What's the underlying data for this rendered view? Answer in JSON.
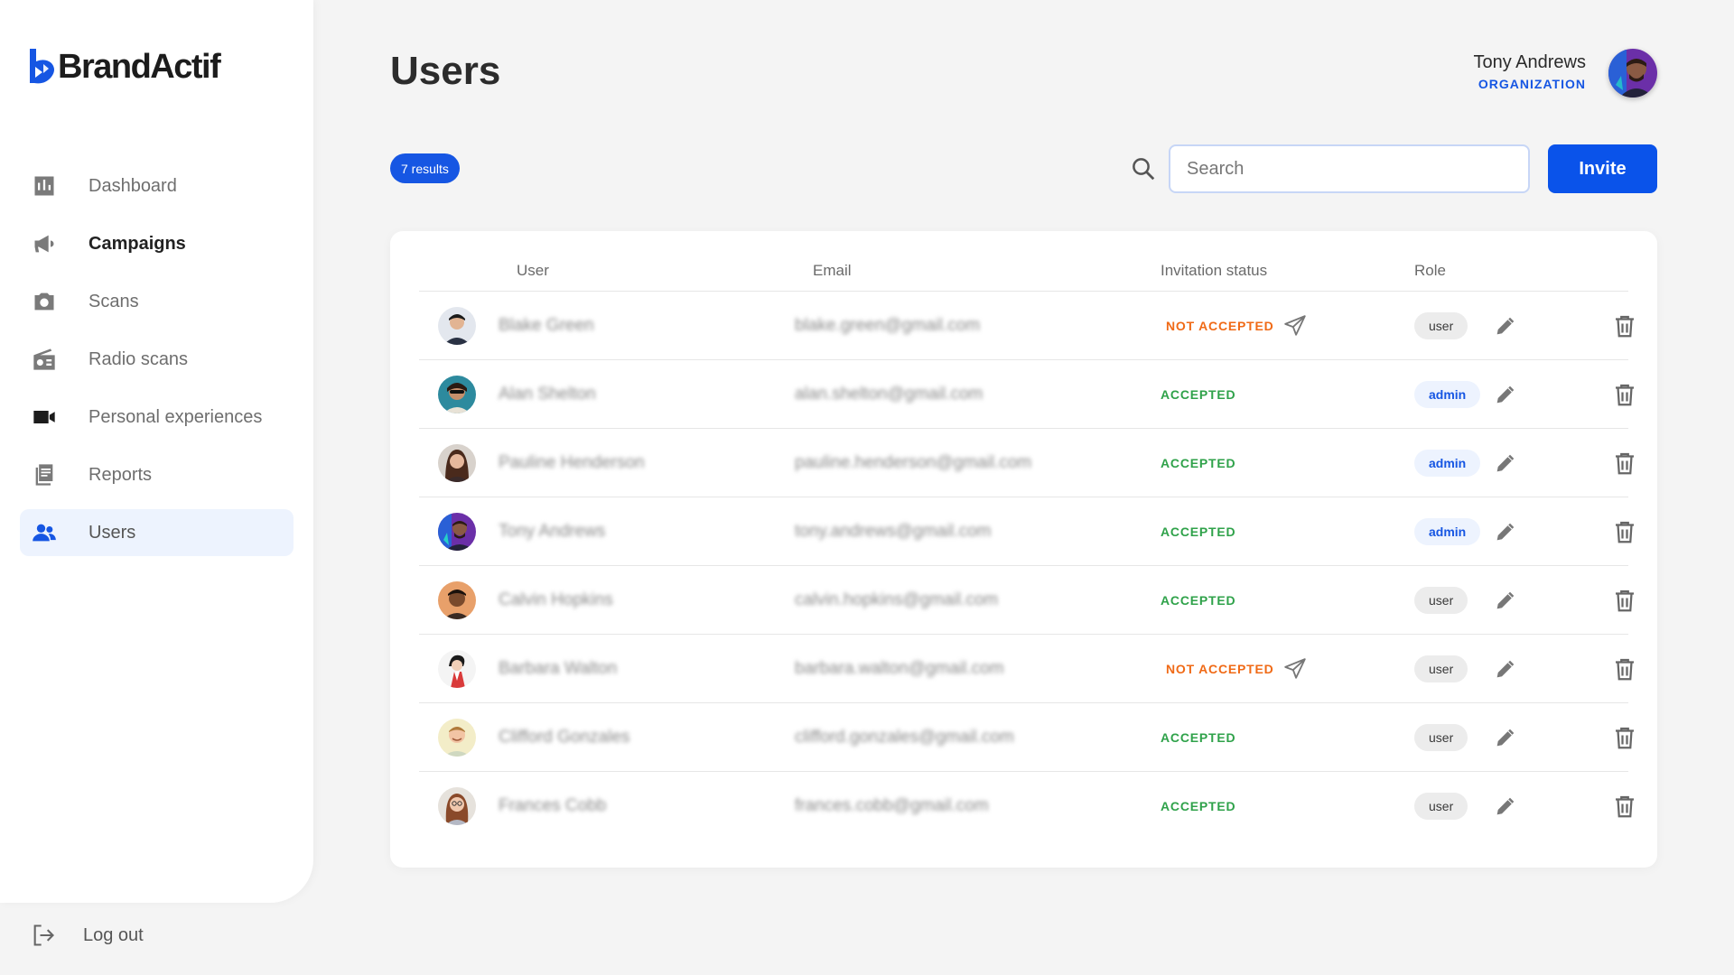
{
  "app": {
    "brand": "BrandActif",
    "brand_color": "#1656e3"
  },
  "sidebar": {
    "items": [
      {
        "label": "Dashboard",
        "icon": "bar-chart-icon"
      },
      {
        "label": "Campaigns",
        "icon": "megaphone-icon"
      },
      {
        "label": "Scans",
        "icon": "camera-icon"
      },
      {
        "label": "Radio scans",
        "icon": "radio-icon"
      },
      {
        "label": "Personal experiences",
        "icon": "video-camera-icon"
      },
      {
        "label": "Reports",
        "icon": "reports-icon"
      },
      {
        "label": "Users",
        "icon": "users-icon",
        "active": true
      }
    ],
    "logout_label": "Log out"
  },
  "header": {
    "title": "Users",
    "user_name": "Tony Andrews",
    "user_org": "ORGANIZATION"
  },
  "toolbar": {
    "results_label": "7 results",
    "search_placeholder": "Search",
    "invite_label": "Invite"
  },
  "table": {
    "columns": [
      "User",
      "Email",
      "Invitation status",
      "Role"
    ],
    "rows": [
      {
        "name": "Blake Green",
        "email": "blake.green@gmail.com",
        "status": "NOT ACCEPTED",
        "accepted": false,
        "role": "user"
      },
      {
        "name": "Alan Shelton",
        "email": "alan.shelton@gmail.com",
        "status": "ACCEPTED",
        "accepted": true,
        "role": "admin"
      },
      {
        "name": "Pauline Henderson",
        "email": "pauline.henderson@gmail.com",
        "status": "ACCEPTED",
        "accepted": true,
        "role": "admin"
      },
      {
        "name": "Tony Andrews",
        "email": "tony.andrews@gmail.com",
        "status": "ACCEPTED",
        "accepted": true,
        "role": "admin"
      },
      {
        "name": "Calvin Hopkins",
        "email": "calvin.hopkins@gmail.com",
        "status": "ACCEPTED",
        "accepted": true,
        "role": "user"
      },
      {
        "name": "Barbara Walton",
        "email": "barbara.walton@gmail.com",
        "status": "NOT ACCEPTED",
        "accepted": false,
        "role": "user"
      },
      {
        "name": "Clifford Gonzales",
        "email": "clifford.gonzales@gmail.com",
        "status": "ACCEPTED",
        "accepted": true,
        "role": "user"
      },
      {
        "name": "Frances Cobb",
        "email": "frances.cobb@gmail.com",
        "status": "ACCEPTED",
        "accepted": true,
        "role": "user"
      }
    ]
  },
  "colors": {
    "accepted": "#2fa24a",
    "not_accepted": "#f06a16",
    "primary": "#0a53ea"
  }
}
